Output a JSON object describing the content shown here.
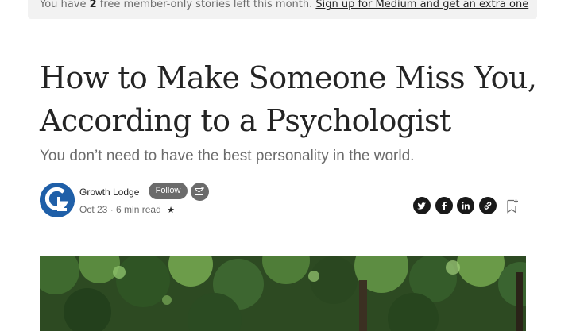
{
  "banner": {
    "prefix": "You have",
    "count": "2",
    "middle": "free member-only stories left this month.",
    "link": "Sign up for Medium and get an extra one"
  },
  "article": {
    "title": "How to Make Someone Miss You, According to a Psychologist",
    "subtitle": "You don’t need to have the best personality in the world."
  },
  "author": {
    "name": "Growth Lodge",
    "follow_label": "Follow",
    "avatar_initials": "GL",
    "brand_color": "#1f5fa8"
  },
  "meta": {
    "date": "Oct 23",
    "separator": "·",
    "read_time": "6 min read",
    "star": "★"
  },
  "share": {
    "icons": [
      "twitter-icon",
      "facebook-icon",
      "linkedin-icon",
      "link-icon"
    ],
    "bookmark": "bookmark-add-icon"
  },
  "colors": {
    "text_primary": "#242424",
    "text_secondary": "#6b6b6b",
    "follow_bg": "#6b6b6b",
    "share_bg": "#191919"
  }
}
